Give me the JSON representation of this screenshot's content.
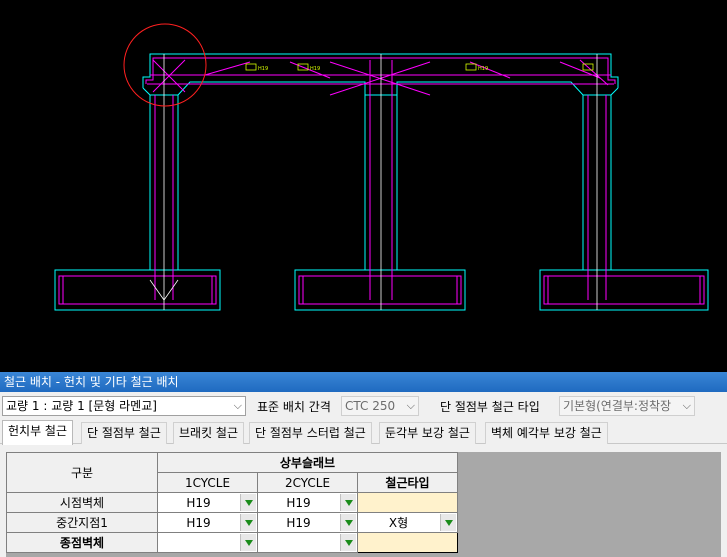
{
  "window": {
    "title": "철근 배치 - 헌치 및 기타 철근 배치"
  },
  "toolbar": {
    "bridge_select": "교량 1 : 교량 1 [문형 라멘교]",
    "spacing_label": "표준 배치 간격",
    "spacing_value": "CTC 250",
    "end_type_label": "단 절점부 철근 타입",
    "end_type_value": "기본형(연결부:정착장"
  },
  "tabs": [
    {
      "label": "헌치부 철근"
    },
    {
      "label": "단 절점부 철근"
    },
    {
      "label": "브래킷 철근"
    },
    {
      "label": "단 절점부 스터럽 철근"
    },
    {
      "label": "둔각부 보강 철근"
    },
    {
      "label": "벽체 예각부 보강 철근"
    }
  ],
  "grid": {
    "col_header": "구분",
    "group_header": "상부슬래브",
    "sub_headers": [
      "1CYCLE",
      "2CYCLE",
      "철근타입"
    ],
    "rows": [
      {
        "label": "시점벽체",
        "c1": "H19",
        "c2": "H19",
        "type": ""
      },
      {
        "label": "중간지점1",
        "c1": "H19",
        "c2": "H19",
        "type": "X형"
      },
      {
        "label": "종점벽체",
        "c1": "",
        "c2": "",
        "type": ""
      }
    ]
  },
  "drawing": {
    "colors": {
      "outline": "#00ffff",
      "rebar": "#ff00ff",
      "white": "#ffffff",
      "marker": "#ff2020",
      "note": "#d8ff00"
    },
    "note_text": "H19"
  }
}
